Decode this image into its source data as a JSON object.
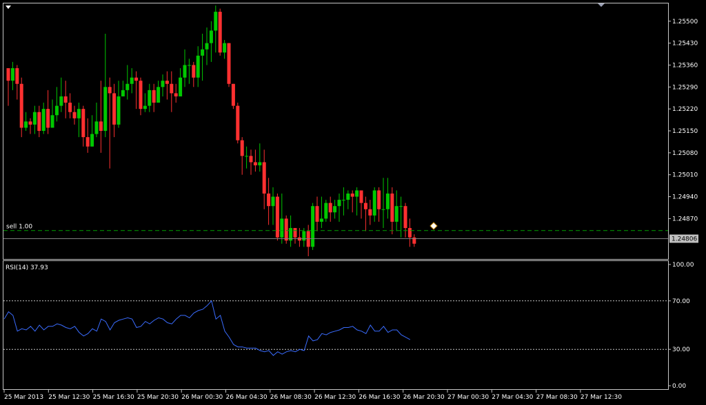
{
  "colors": {
    "background": "#000000",
    "frame": "#c8c8c8",
    "text": "#ffffff",
    "bull": "#00c800",
    "bear": "#ff3030",
    "wick_bull": "#00c800",
    "wick_bear": "#ff3030",
    "sell_line": "#00a000",
    "bid_line": "#808080",
    "rsi_line": "#3a6cff",
    "level_line": "#c8c8c8"
  },
  "icons": {
    "menu": "triangle-down-icon",
    "shift": "chart-shift-triangle-icon",
    "trade": "trade-arrow-icon"
  },
  "chart_data": [
    {
      "type": "candlestick",
      "symbol_period": "",
      "y_ticks": [
        "1.25500",
        "1.25430",
        "1.25360",
        "1.25290",
        "1.25220",
        "1.25150",
        "1.25080",
        "1.25010",
        "1.24940",
        "1.24870"
      ],
      "ylim": [
        1.2475,
        1.2555
      ],
      "x_ticks": [
        "25 Mar 2013",
        "25 Mar 12:30",
        "25 Mar 16:30",
        "25 Mar 20:30",
        "26 Mar 00:30",
        "26 Mar 04:30",
        "26 Mar 08:30",
        "26 Mar 12:30",
        "26 Mar 16:30",
        "26 Mar 20:30",
        "27 Mar 00:30",
        "27 Mar 04:30",
        "27 Mar 08:30",
        "27 Mar 12:30"
      ],
      "current_price": "1.24806",
      "sell_label": "sell 1.00",
      "sell_price": 1.24832,
      "closes": [
        1.2531,
        1.2535,
        1.253,
        1.2516,
        1.2518,
        1.2517,
        1.2521,
        1.2515,
        1.2522,
        1.2516,
        1.252,
        1.2523,
        1.2526,
        1.2524,
        1.2521,
        1.2519,
        1.2522,
        1.2513,
        1.251,
        1.2514,
        1.2518,
        1.2515,
        1.2529,
        1.2527,
        1.2517,
        1.2526,
        1.2528,
        1.253,
        1.2532,
        1.2531,
        1.2522,
        1.2523,
        1.2528,
        1.2524,
        1.2529,
        1.2531,
        1.253,
        1.2527,
        1.2526,
        1.2532,
        1.2536,
        1.2536,
        1.2532,
        1.2539,
        1.2541,
        1.2543,
        1.2547,
        1.2553,
        1.254,
        1.2543,
        1.253,
        1.2523,
        1.2512,
        1.2507,
        1.2507,
        1.2505,
        1.2504,
        1.2505,
        1.2495,
        1.2491,
        1.2494,
        1.2481,
        1.2487,
        1.248,
        1.2484,
        1.2481,
        1.248,
        1.2483,
        1.2478,
        1.2491,
        1.2486,
        1.2487,
        1.2492,
        1.2489,
        1.2491,
        1.2493,
        1.2493,
        1.2495,
        1.2494,
        1.2496,
        1.2492,
        1.249,
        1.2488,
        1.2496,
        1.249,
        1.249,
        1.2495,
        1.2486,
        1.2491,
        1.2491,
        1.2484,
        1.2481,
        1.2479
      ],
      "highs": [
        1.2533,
        1.2537,
        1.2536,
        1.2532,
        1.2521,
        1.2519,
        1.2523,
        1.2523,
        1.2524,
        1.2528,
        1.2525,
        1.2529,
        1.2532,
        1.2531,
        1.2527,
        1.2523,
        1.2524,
        1.2523,
        1.2519,
        1.252,
        1.2524,
        1.2531,
        1.2546,
        1.2532,
        1.253,
        1.2531,
        1.2531,
        1.2536,
        1.2535,
        1.2534,
        1.2532,
        1.2527,
        1.253,
        1.253,
        1.2531,
        1.2533,
        1.2534,
        1.2534,
        1.253,
        1.2535,
        1.2541,
        1.2538,
        1.2537,
        1.2542,
        1.2546,
        1.2548,
        1.255,
        1.2555,
        1.2554,
        1.2544,
        1.2543,
        1.253,
        1.2524,
        1.2513,
        1.251,
        1.2509,
        1.2509,
        1.2511,
        1.2509,
        1.25,
        1.2497,
        1.2495,
        1.2495,
        1.2488,
        1.2488,
        1.2484,
        1.2484,
        1.2484,
        1.2485,
        1.2492,
        1.2494,
        1.2494,
        1.2493,
        1.2494,
        1.2493,
        1.2495,
        1.2497,
        1.2496,
        1.2496,
        1.2497,
        1.2496,
        1.2494,
        1.2493,
        1.2497,
        1.2497,
        1.25,
        1.25,
        1.2497,
        1.2496,
        1.2494,
        1.2492,
        1.2487,
        1.2482
      ],
      "lows": [
        1.2523,
        1.2528,
        1.2525,
        1.2513,
        1.2515,
        1.2514,
        1.2514,
        1.2513,
        1.2514,
        1.2514,
        1.2516,
        1.2518,
        1.2521,
        1.2519,
        1.2519,
        1.2517,
        1.2513,
        1.251,
        1.2508,
        1.251,
        1.2513,
        1.2508,
        1.2513,
        1.2503,
        1.2513,
        1.2516,
        1.2526,
        1.2525,
        1.2527,
        1.2522,
        1.252,
        1.2521,
        1.2521,
        1.2521,
        1.2524,
        1.2526,
        1.2525,
        1.2521,
        1.2524,
        1.2526,
        1.2529,
        1.253,
        1.2529,
        1.2529,
        1.2531,
        1.2536,
        1.2537,
        1.254,
        1.2539,
        1.2538,
        1.2529,
        1.2522,
        1.2511,
        1.2501,
        1.2503,
        1.2501,
        1.2502,
        1.2502,
        1.249,
        1.2485,
        1.2485,
        1.248,
        1.2479,
        1.2479,
        1.2478,
        1.2479,
        1.2478,
        1.2478,
        1.2475,
        1.2477,
        1.2483,
        1.2484,
        1.2486,
        1.2486,
        1.2487,
        1.2486,
        1.2488,
        1.249,
        1.2489,
        1.2488,
        1.2487,
        1.2483,
        1.2485,
        1.2486,
        1.2486,
        1.2484,
        1.2487,
        1.2482,
        1.2483,
        1.2481,
        1.2481,
        1.2478,
        1.2478
      ]
    },
    {
      "type": "line",
      "label": "RSI(14) 37.93",
      "y_ticks": [
        "100.00",
        "70.00",
        "30.00",
        "0.00"
      ],
      "ylim": [
        0,
        100
      ],
      "levels": [
        70,
        30
      ],
      "values": [
        55,
        61,
        58,
        45,
        47,
        46,
        49,
        45,
        50,
        46,
        49,
        49,
        51,
        50,
        48,
        47,
        49,
        44,
        41,
        43,
        47,
        45,
        55,
        53,
        46,
        52,
        54,
        55,
        56,
        55,
        48,
        49,
        53,
        51,
        54,
        56,
        55,
        52,
        51,
        55,
        58,
        58,
        56,
        60,
        62,
        63,
        66,
        70,
        55,
        58,
        45,
        40,
        34,
        32,
        32,
        31,
        31,
        31,
        29,
        28,
        29,
        25,
        28,
        26,
        28,
        29,
        28,
        30,
        29,
        41,
        37,
        38,
        43,
        42,
        44,
        45,
        46,
        48,
        48,
        49,
        46,
        45,
        43,
        50,
        45,
        45,
        49,
        44,
        46,
        46,
        42,
        40,
        38
      ]
    }
  ]
}
